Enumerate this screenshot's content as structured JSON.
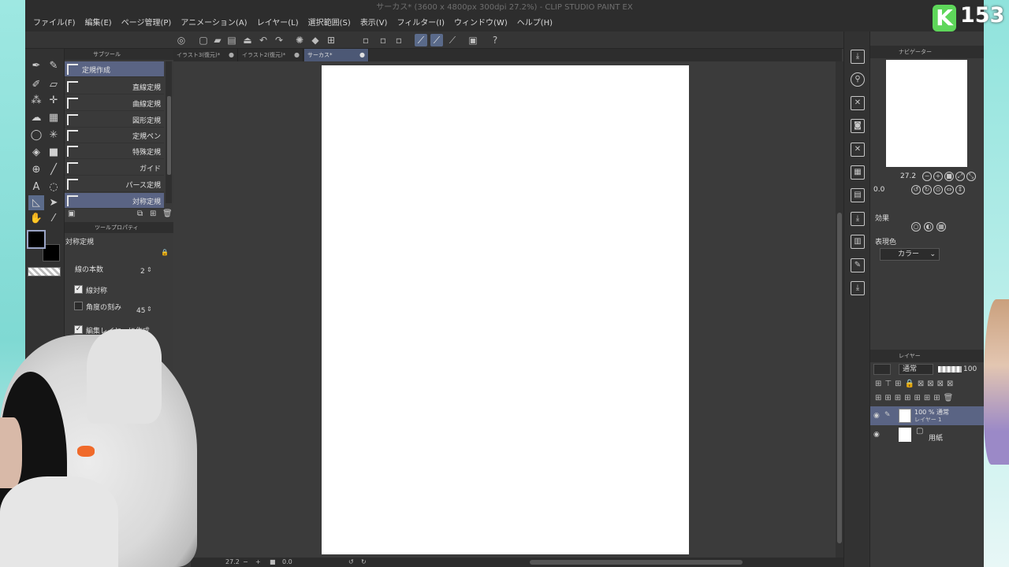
{
  "window": {
    "title": "サーカス* (3600 x 4800px 300dpi 27.2%)  - CLIP STUDIO PAINT EX"
  },
  "menu": [
    "ファイル(F)",
    "編集(E)",
    "ページ管理(P)",
    "アニメーション(A)",
    "レイヤー(L)",
    "選択範囲(S)",
    "表示(V)",
    "フィルター(I)",
    "ウィンドウ(W)",
    "ヘルプ(H)"
  ],
  "subtool_panel": {
    "title": "サブツール",
    "items": [
      {
        "label": "定規作成",
        "active": true
      },
      {
        "label": "直線定規"
      },
      {
        "label": "曲線定規"
      },
      {
        "label": "図形定規"
      },
      {
        "label": "定規ペン"
      },
      {
        "label": "特殊定規"
      },
      {
        "label": "ガイド"
      },
      {
        "label": "パース定規"
      },
      {
        "label": "対称定規",
        "active": true
      }
    ]
  },
  "tool_property": {
    "title": "ツールプロパティ",
    "tool_name": "対称定規",
    "line_count_label": "線の本数",
    "line_count_value": "2",
    "line_symmetric_label": "線対称",
    "line_symmetric_checked": true,
    "angle_step_label": "角度の刻み",
    "angle_step_value": "45",
    "angle_step_checked": false,
    "create_on_edit_layer_label": "編集レイヤーに作成",
    "create_on_edit_layer_checked": true
  },
  "tabs": [
    {
      "label": "イラスト3(復元)*",
      "close": "●"
    },
    {
      "label": "イラスト2(復元)*",
      "close": "●"
    },
    {
      "label": "サーカス*",
      "close": "●",
      "active": true
    }
  ],
  "status": {
    "zoom": "27.2",
    "rotation": "0.0"
  },
  "navigator": {
    "title": "ナビゲーター",
    "zoom": "27.2",
    "rotation": "0.0"
  },
  "effect": {
    "title": "効果",
    "expression_color_label": "表現色",
    "expression_color_value": "カラー"
  },
  "layer_panel": {
    "title": "レイヤー",
    "blend_mode": "通常",
    "opacity": "100",
    "layers": [
      {
        "line1": "100 % 通常",
        "line2": "レイヤー 1",
        "active": true
      },
      {
        "line1": "用紙",
        "line2": ""
      }
    ]
  },
  "overlay": {
    "badge_letter": "K",
    "badge_number": "153"
  },
  "colors": {
    "app_bg": "#3a3a3a",
    "accent": "#5a6484",
    "canvas_paper": "#ffffff",
    "badge_green": "#5ed65a"
  }
}
